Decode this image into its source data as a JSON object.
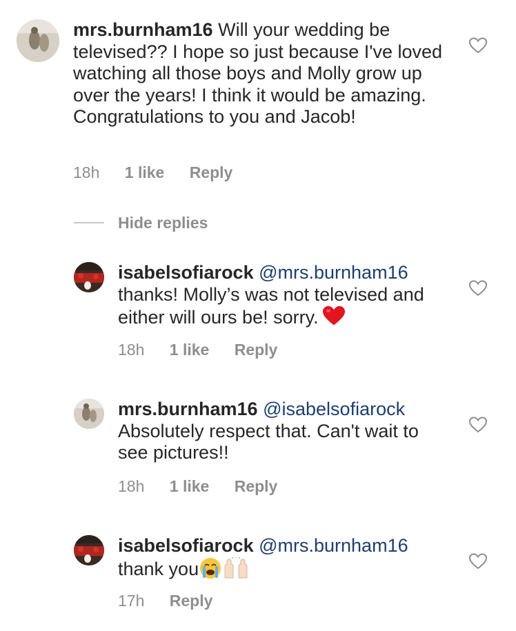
{
  "comments": [
    {
      "username": "mrs.burnham16",
      "text": "Will your wedding be televised?? I hope so just because I've loved watching all those boys and Molly grow up over the years! I think it would be amazing. Congratulations to you and Jacob!",
      "time": "18h",
      "likes": "1 like",
      "reply": "Reply"
    }
  ],
  "hide_replies": "Hide replies",
  "replies": [
    {
      "username": "isabelsofiarock",
      "mention": "@mrs.burnham16",
      "text": "thanks! Molly’s was not televised and either will ours be! sorry.",
      "emoji": "red-heart",
      "time": "18h",
      "likes": "1 like",
      "reply": "Reply"
    },
    {
      "username": "mrs.burnham16",
      "mention": "@isabelsofiarock",
      "text": "Absolutely respect that. Can't wait to see pictures!!",
      "time": "18h",
      "likes": "1 like",
      "reply": "Reply"
    },
    {
      "username": "isabelsofiarock",
      "mention": "@mrs.burnham16",
      "text": "thank you",
      "emoji": "loudly-crying-face, raising-hands",
      "time": "17h",
      "reply": "Reply"
    }
  ]
}
